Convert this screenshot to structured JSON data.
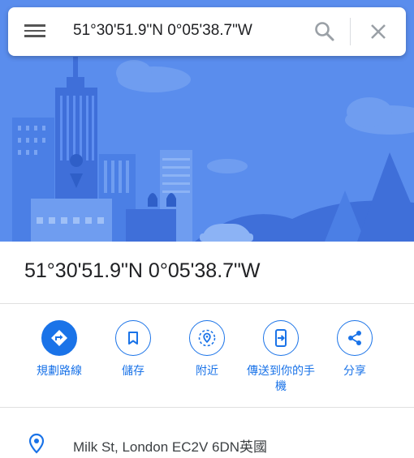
{
  "search": {
    "query": "51°30'51.9\"N 0°05'38.7\"W"
  },
  "place": {
    "title": "51°30'51.9\"N 0°05'38.7\"W",
    "address": "Milk St, London EC2V 6DN英國"
  },
  "actions": [
    {
      "label": "規劃路線",
      "icon": "directions-icon"
    },
    {
      "label": "儲存",
      "icon": "bookmark-icon"
    },
    {
      "label": "附近",
      "icon": "nearby-icon"
    },
    {
      "label": "傳送到你的手機",
      "icon": "send-to-phone-icon"
    },
    {
      "label": "分享",
      "icon": "share-icon"
    }
  ],
  "colors": {
    "accent": "#1a73e8",
    "hero_bg": "#5a8ded",
    "hero_dark": "#3f6fd9"
  }
}
